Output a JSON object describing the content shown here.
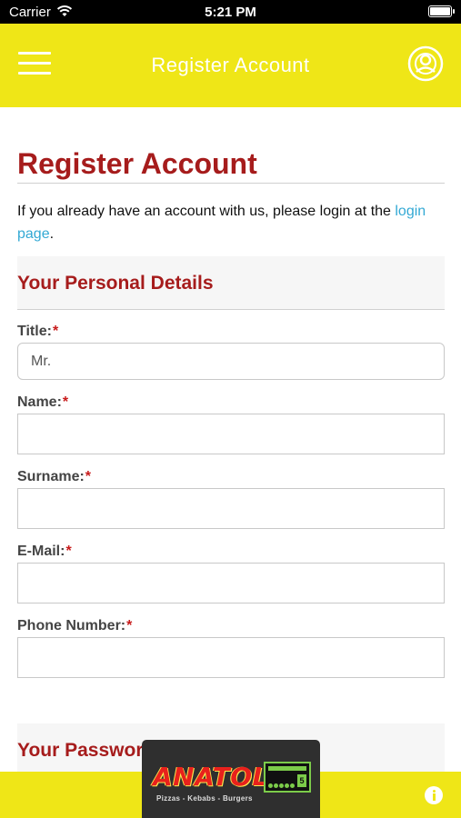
{
  "status_bar": {
    "carrier": "Carrier",
    "time": "5:21 PM"
  },
  "header": {
    "title": "Register Account"
  },
  "page": {
    "title": "Register Account",
    "intro_text": "If you already have an account with us, please login at the ",
    "login_link": "login page",
    "intro_end": "."
  },
  "sections": {
    "personal": "Your Personal Details",
    "password": "Your Password"
  },
  "form": {
    "required_mark": "*",
    "title_label": "Title:",
    "title_value": "Mr.",
    "name_label": "Name:",
    "name_value": "",
    "surname_label": "Surname:",
    "surname_value": "",
    "email_label": "E-Mail:",
    "email_value": "",
    "phone_label": "Phone Number:",
    "phone_value": ""
  },
  "banner": {
    "brand": "ANATOLIA",
    "tagline": "Pizzas - Kebabs - Burgers",
    "hygiene_score": "5"
  },
  "colors": {
    "header_yellow": "#efe617",
    "heading_red": "#a61c1c",
    "link_blue": "#33a9d4",
    "required_red": "#c81b1b"
  },
  "icons": {
    "menu": "hamburger-menu-icon",
    "user": "user-account-icon",
    "info": "info-icon",
    "wifi": "wifi-icon",
    "battery": "battery-icon"
  }
}
